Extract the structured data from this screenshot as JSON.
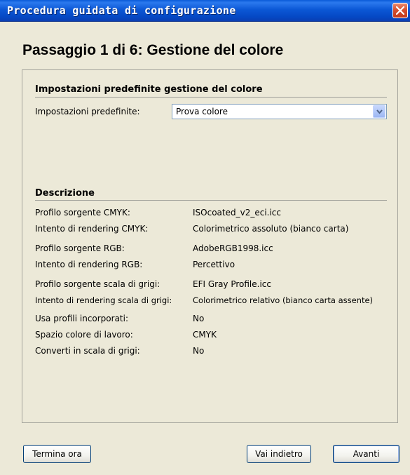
{
  "window": {
    "title": "Procedura guidata di configurazione"
  },
  "step_heading": "Passaggio 1 di 6: Gestione del colore",
  "presets_section": {
    "title": "Impostazioni predefinite gestione del colore",
    "label": "Impostazioni predefinite:",
    "selected_value": "Prova colore"
  },
  "description": {
    "title": "Descrizione",
    "rows": [
      {
        "label": "Profilo sorgente CMYK:",
        "value": "ISOcoated_v2_eci.icc"
      },
      {
        "label": "Intento di rendering CMYK:",
        "value": "Colorimetrico assoluto (bianco carta)"
      },
      {
        "label": "Profilo sorgente RGB:",
        "value": "AdobeRGB1998.icc"
      },
      {
        "label": "Intento di rendering RGB:",
        "value": "Percettivo"
      },
      {
        "label": "Profilo sorgente scala di grigi:",
        "value": "EFI Gray Profile.icc"
      },
      {
        "label": "Intento di rendering scala di grigi:",
        "value": "Colorimetrico relativo (bianco carta assente)"
      },
      {
        "label": "Usa profili incorporati:",
        "value": "No"
      },
      {
        "label": "Spazio colore di lavoro:",
        "value": "CMYK"
      },
      {
        "label": "Converti in scala di grigi:",
        "value": "No"
      }
    ]
  },
  "buttons": {
    "finish_now": "Termina ora",
    "back": "Vai indietro",
    "next": "Avanti"
  },
  "colors": {
    "titlebar": "#0a5bd8",
    "dialog_bg": "#ece9d8",
    "close_button": "#d6502f",
    "button_border": "#003c74"
  }
}
